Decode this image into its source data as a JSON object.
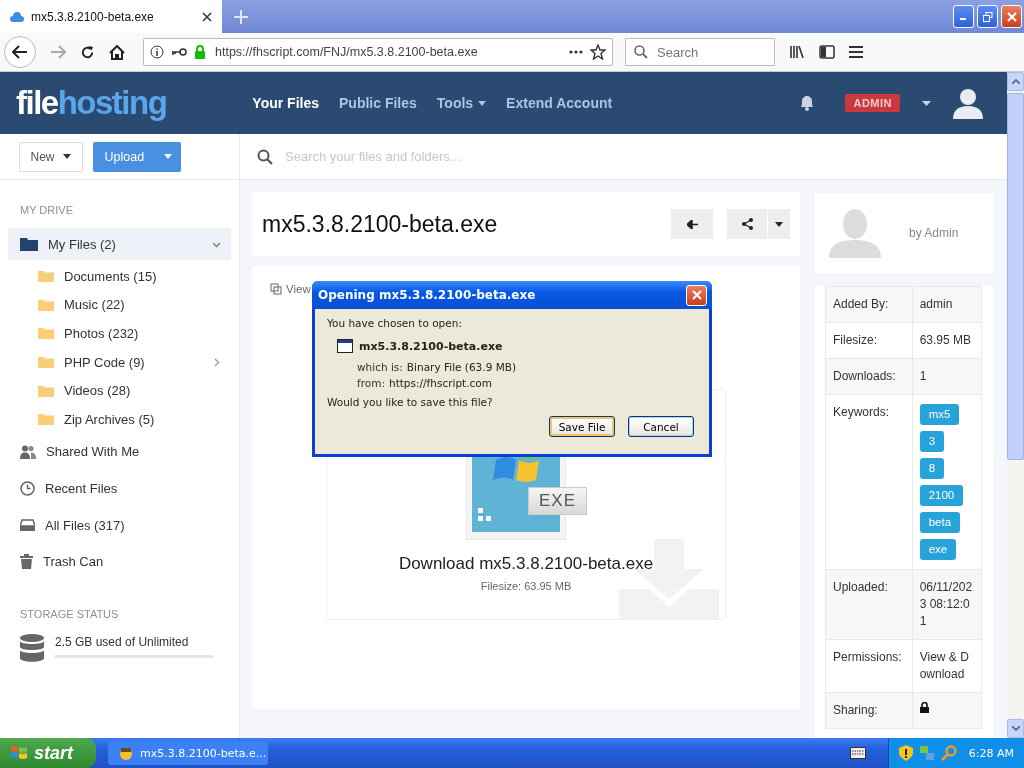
{
  "browser": {
    "tab_title": "mx5.3.8.2100-beta.exe",
    "url": "https://fhscript.com/FNJ/mx5.3.8.2100-beta.exe",
    "search_placeholder": "Search"
  },
  "site": {
    "logo_a": "file",
    "logo_b": "hosting",
    "role_badge": "ADMIN",
    "nav": [
      {
        "label": "Your Files",
        "selected": true,
        "dropdown": false
      },
      {
        "label": "Public Files",
        "selected": false,
        "dropdown": false
      },
      {
        "label": "Tools",
        "selected": false,
        "dropdown": true
      },
      {
        "label": "Extend Account",
        "selected": false,
        "dropdown": false
      }
    ]
  },
  "toolbar": {
    "new_button": "New",
    "upload_button": "Upload",
    "search_placeholder": "Search your files and folders..."
  },
  "sidebar": {
    "section_title": "MY DRIVE",
    "items": [
      {
        "label": "My Files (2)",
        "selected": true,
        "expanded": true,
        "children": [
          {
            "label": "Documents (15)"
          },
          {
            "label": "Music (22)"
          },
          {
            "label": "Photos (232)"
          },
          {
            "label": "PHP Code (9)",
            "expanded": false
          },
          {
            "label": "Videos (28)"
          },
          {
            "label": "Zip Archives (5)"
          }
        ]
      },
      {
        "label": "Shared With Me",
        "selected": false
      },
      {
        "label": "Recent Files",
        "selected": false
      },
      {
        "label": "All Files (317)",
        "selected": false
      },
      {
        "label": "Trash Can",
        "selected": false
      }
    ],
    "storage_title": "STORAGE STATUS",
    "storage_text": "2.5 GB used of Unlimited",
    "storage": {
      "level": 0
    }
  },
  "file": {
    "title": "mx5.3.8.2100-beta.exe",
    "tab_label": "View",
    "icon_label": "EXE",
    "download_title": "Download mx5.3.8.2100-beta.exe",
    "download_filesize": "Filesize: 63.95 MB"
  },
  "owner": {
    "by": "by Admin"
  },
  "details": [
    {
      "label": "Added By:",
      "kind": "text",
      "value": "admin"
    },
    {
      "label": "Filesize:",
      "kind": "text",
      "value": "63.95 MB"
    },
    {
      "label": "Downloads:",
      "kind": "text",
      "value": "1"
    },
    {
      "label": "Keywords:",
      "kind": "tags",
      "tags": [
        "mx5",
        "3",
        "8",
        "2100",
        "beta",
        "exe"
      ]
    },
    {
      "label": "Uploaded:",
      "kind": "text",
      "value": "06/11/2023 08:12:01"
    },
    {
      "label": "Permissions:",
      "kind": "text",
      "value": "View & Download"
    },
    {
      "label": "Sharing:",
      "kind": "lock"
    }
  ],
  "dialog": {
    "title": "Opening mx5.3.8.2100-beta.exe",
    "intro": "You have chosen to open:",
    "filename": "mx5.3.8.2100-beta.exe",
    "which_is_label": "which is:",
    "which_is": "Binary File (63.9 MB)",
    "from_label": "from:",
    "from": "https://fhscript.com",
    "question": "Would you like to save this file?",
    "buttons": [
      {
        "label": "Save File",
        "focused": true
      },
      {
        "label": "Cancel",
        "focused": false
      }
    ]
  },
  "taskbar": {
    "start": "start",
    "tasks": [
      {
        "label": "mx5.3.8.2100-beta.e..."
      }
    ],
    "clock": "6:28 AM"
  }
}
